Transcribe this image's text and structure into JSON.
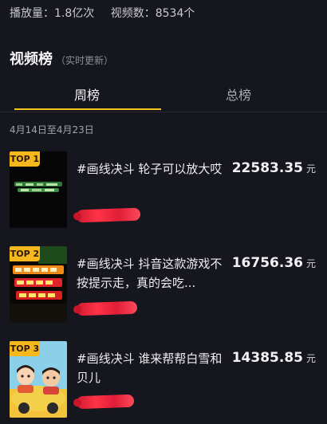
{
  "stats": {
    "plays": "播放量：1.8亿次",
    "videos": "视频数：8534个"
  },
  "section": {
    "title": "视频榜",
    "subtitle": "（实时更新）"
  },
  "tabs": [
    {
      "label": "周榜",
      "active": true
    },
    {
      "label": "总榜",
      "active": false
    }
  ],
  "date_range": "4月14日至4月23日",
  "ranking": [
    {
      "rank": "TOP 1",
      "title": "#画线决斗 轮子可以放大哎",
      "amount": "22583.35",
      "unit": "元"
    },
    {
      "rank": "TOP 2",
      "title": "#画线决斗 抖音这款游戏不按提示走，真的会吃...",
      "amount": "16756.36",
      "unit": "元"
    },
    {
      "rank": "TOP 3",
      "title": "#画线决斗 谁来帮帮白雪和贝儿",
      "amount": "14385.85",
      "unit": "元"
    }
  ],
  "colors": {
    "background": "#15161e",
    "accent": "#f4c51f",
    "badge": "#f6b81d",
    "redaction": "#ff3346"
  }
}
